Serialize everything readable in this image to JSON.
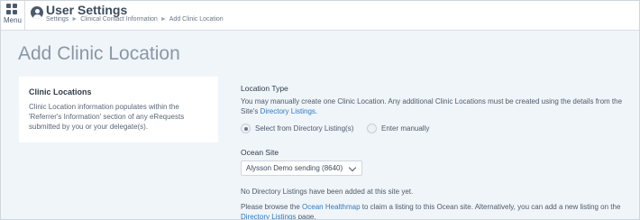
{
  "header": {
    "menu_label": "Menu",
    "title": "User Settings",
    "breadcrumbs": [
      "Settings",
      "Clinical Contact Information",
      "Add Clinic Location"
    ],
    "breadcrumb_sep": "►"
  },
  "page": {
    "heading": "Add Clinic Location"
  },
  "sidebar_card": {
    "title": "Clinic Locations",
    "body": "Clinic Location information populates within the 'Referrer's Information' section of any eRequests submitted by you or your delegate(s)."
  },
  "location_type": {
    "label": "Location Type",
    "help_line1": "You may manually create one Clinic Location. Any additional Clinic Locations must be created using the details from the",
    "help_line2_prefix": "Site's ",
    "help_line2_link": "Directory Listings",
    "help_line2_suffix": ".",
    "options": [
      {
        "label": "Select from Directory Listing(s)",
        "checked": true
      },
      {
        "label": "Enter manually",
        "checked": false
      }
    ]
  },
  "ocean_site": {
    "label": "Ocean Site",
    "selected": "Alysson Demo sending (8640)"
  },
  "notice": {
    "no_listings": "No Directory Listings have been added at this site yet.",
    "browse_prefix": "Please browse the ",
    "browse_link": "Ocean Healthmap",
    "browse_middle": " to claim a listing to this Ocean site. Alternatively, you can add a new listing on the",
    "browse_link2": "Directory Listings",
    "browse_suffix": " page."
  },
  "colors": {
    "accent": "#2f7bbf",
    "background": "#f0f5fa"
  },
  "icons": {
    "menu": "grid-icon",
    "user": "user-circle-icon",
    "select": "chevron-down-icon"
  }
}
